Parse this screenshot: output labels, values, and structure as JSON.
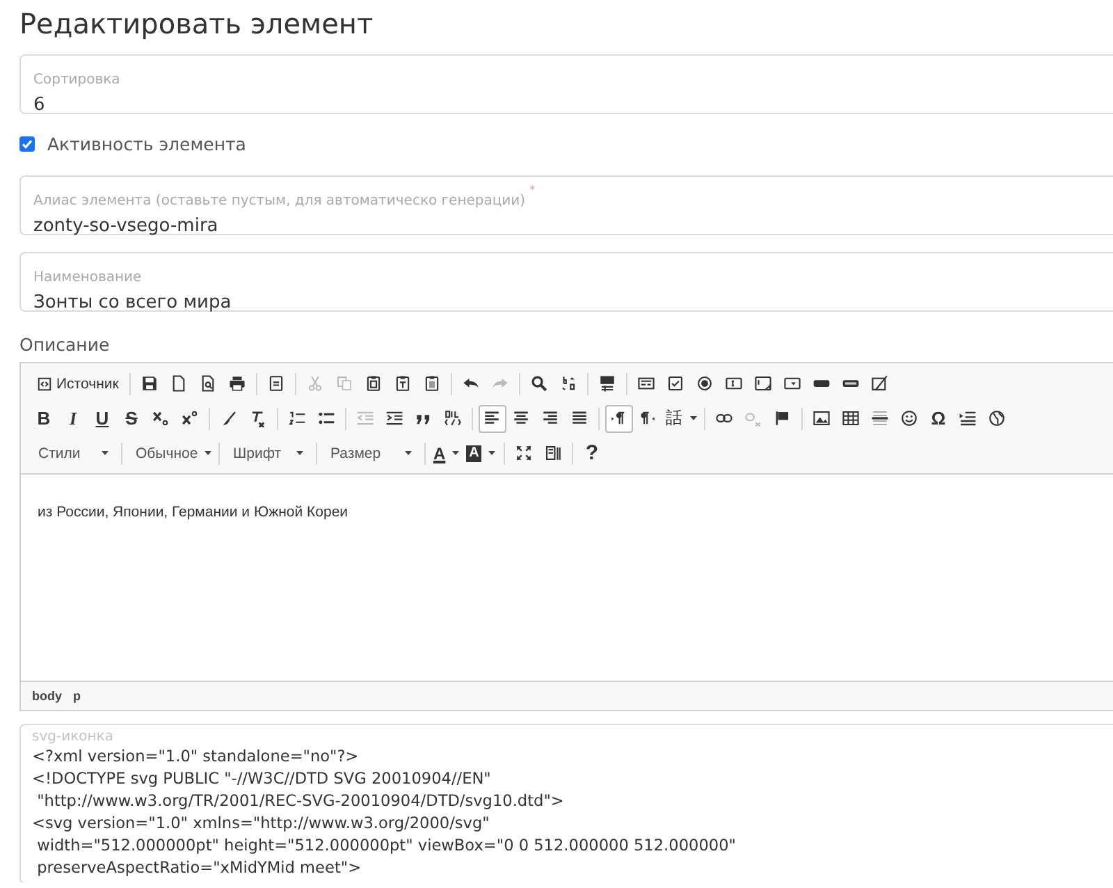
{
  "title": "Редактировать элемент",
  "sort_field": {
    "label": "Сортировка",
    "value": "6"
  },
  "active": {
    "label": "Активность элемента",
    "checked": true
  },
  "alias_field": {
    "label": "Алиас элемента (оставьте пустым, для автоматическо генерации)",
    "required_mark": "*",
    "value": "zonty-so-vsego-mira"
  },
  "name_field": {
    "label": "Наименование",
    "value": "Зонты со всего мира"
  },
  "description": {
    "label": "Описание",
    "toolbar_rows": [
      [
        [
          {
            "kind": "source",
            "label": "Источник",
            "disabled": false,
            "selected": false
          }
        ],
        [
          {
            "kind": "save",
            "disabled": false,
            "selected": false
          },
          {
            "kind": "new-page",
            "disabled": false,
            "selected": false
          },
          {
            "kind": "preview",
            "disabled": false,
            "selected": false
          },
          {
            "kind": "print",
            "disabled": false,
            "selected": false
          }
        ],
        [
          {
            "kind": "templates",
            "disabled": false,
            "selected": false
          }
        ],
        [
          {
            "kind": "cut",
            "disabled": true,
            "selected": false
          },
          {
            "kind": "copy",
            "disabled": true,
            "selected": false
          },
          {
            "kind": "paste",
            "disabled": false,
            "selected": false
          },
          {
            "kind": "paste-text",
            "disabled": false,
            "selected": false
          },
          {
            "kind": "paste-word",
            "disabled": false,
            "selected": false
          }
        ],
        [
          {
            "kind": "undo",
            "disabled": false,
            "selected": false
          },
          {
            "kind": "redo",
            "disabled": true,
            "selected": false
          }
        ],
        [
          {
            "kind": "find",
            "disabled": false,
            "selected": false
          },
          {
            "kind": "replace",
            "disabled": false,
            "selected": false
          }
        ],
        [
          {
            "kind": "select-all",
            "disabled": false,
            "selected": false
          }
        ],
        [
          {
            "kind": "form",
            "disabled": false,
            "selected": false
          },
          {
            "kind": "checkbox",
            "disabled": false,
            "selected": false
          },
          {
            "kind": "radio",
            "disabled": false,
            "selected": false
          },
          {
            "kind": "text-field",
            "disabled": false,
            "selected": false
          },
          {
            "kind": "textarea",
            "disabled": false,
            "selected": false
          },
          {
            "kind": "select",
            "disabled": false,
            "selected": false
          },
          {
            "kind": "form-button",
            "disabled": false,
            "selected": false
          },
          {
            "kind": "image-button",
            "disabled": false,
            "selected": false
          },
          {
            "kind": "hidden-field",
            "disabled": false,
            "selected": false
          }
        ]
      ],
      [
        [
          {
            "kind": "bold",
            "label": "B",
            "disabled": false,
            "selected": false
          },
          {
            "kind": "italic",
            "label": "I",
            "disabled": false,
            "selected": false
          },
          {
            "kind": "underline",
            "label": "U",
            "disabled": false,
            "selected": false
          },
          {
            "kind": "strike",
            "label": "S",
            "disabled": false,
            "selected": false
          },
          {
            "kind": "subscript",
            "disabled": false,
            "selected": false
          },
          {
            "kind": "superscript",
            "disabled": false,
            "selected": false
          }
        ],
        [
          {
            "kind": "copy-format",
            "disabled": false,
            "selected": false
          },
          {
            "kind": "remove-format",
            "disabled": false,
            "selected": false
          }
        ],
        [
          {
            "kind": "numbered-list",
            "disabled": false,
            "selected": false
          },
          {
            "kind": "bulleted-list",
            "disabled": false,
            "selected": false
          }
        ],
        [
          {
            "kind": "outdent",
            "disabled": true,
            "selected": false
          },
          {
            "kind": "indent",
            "disabled": false,
            "selected": false
          },
          {
            "kind": "blockquote",
            "disabled": false,
            "selected": false
          },
          {
            "kind": "div",
            "disabled": false,
            "selected": false
          }
        ],
        [
          {
            "kind": "align-left",
            "disabled": false,
            "selected": true
          },
          {
            "kind": "align-center",
            "disabled": false,
            "selected": false
          },
          {
            "kind": "align-right",
            "disabled": false,
            "selected": false
          },
          {
            "kind": "justify",
            "disabled": false,
            "selected": false
          }
        ],
        [
          {
            "kind": "ltr",
            "disabled": false,
            "selected": true
          },
          {
            "kind": "rtl",
            "disabled": false,
            "selected": false
          },
          {
            "kind": "language",
            "label": "話",
            "disabled": false,
            "selected": false
          }
        ],
        [
          {
            "kind": "link",
            "disabled": false,
            "selected": false
          },
          {
            "kind": "unlink",
            "disabled": true,
            "selected": false
          },
          {
            "kind": "anchor",
            "disabled": false,
            "selected": false
          }
        ],
        [
          {
            "kind": "image",
            "disabled": false,
            "selected": false
          },
          {
            "kind": "table",
            "disabled": false,
            "selected": false
          },
          {
            "kind": "hr",
            "disabled": false,
            "selected": false
          },
          {
            "kind": "smiley",
            "disabled": false,
            "selected": false
          },
          {
            "kind": "special-char",
            "label": "Ω",
            "disabled": false,
            "selected": false
          },
          {
            "kind": "page-break",
            "disabled": false,
            "selected": false
          },
          {
            "kind": "iframe",
            "disabled": false,
            "selected": false
          }
        ]
      ],
      [
        [
          {
            "kind": "combo",
            "label": "Стили",
            "disabled": false,
            "selected": false
          }
        ],
        [
          {
            "kind": "combo",
            "label": "Обычное",
            "disabled": false,
            "selected": false
          }
        ],
        [
          {
            "kind": "combo",
            "label": "Шрифт",
            "disabled": false,
            "selected": false
          }
        ],
        [
          {
            "kind": "combo",
            "label": "Размер",
            "disabled": false,
            "selected": false
          }
        ],
        [
          {
            "kind": "text-color",
            "label": "A",
            "disabled": false,
            "selected": false
          },
          {
            "kind": "bg-color",
            "label": "A",
            "disabled": false,
            "selected": false
          }
        ],
        [
          {
            "kind": "maximize",
            "disabled": false,
            "selected": false
          },
          {
            "kind": "show-blocks",
            "disabled": false,
            "selected": false
          }
        ],
        [
          {
            "kind": "about",
            "label": "?",
            "disabled": false,
            "selected": false
          }
        ]
      ]
    ],
    "content": "из России, Японии, Германии и Южной Кореи",
    "path": [
      "body",
      "p"
    ]
  },
  "svg_field": {
    "label": "svg-иконка",
    "lines": [
      "<?xml version=\"1.0\" standalone=\"no\"?>",
      "<!DOCTYPE svg PUBLIC \"-//W3C//DTD SVG 20010904//EN\"",
      " \"http://www.w3.org/TR/2001/REC-SVG-20010904/DTD/svg10.dtd\">",
      "<svg version=\"1.0\" xmlns=\"http://www.w3.org/2000/svg\"",
      " width=\"512.000000pt\" height=\"512.000000pt\" viewBox=\"0 0 512.000000 512.000000\"",
      " preserveAspectRatio=\"xMidYMid meet\">"
    ]
  }
}
